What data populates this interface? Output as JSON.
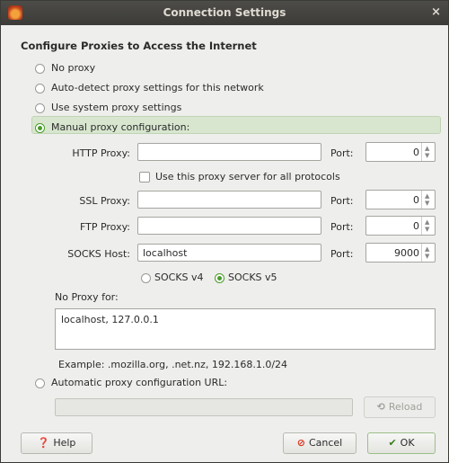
{
  "window": {
    "title": "Connection Settings",
    "close_glyph": "×",
    "app_icon": "firefox-icon"
  },
  "section_heading": "Configure Proxies to Access the Internet",
  "options": {
    "no_proxy": "No proxy",
    "auto_detect": "Auto-detect proxy settings for this network",
    "system_proxy": "Use system proxy settings",
    "manual": "Manual proxy configuration:",
    "selected": "manual"
  },
  "manual": {
    "http": {
      "label": "HTTP Proxy:",
      "value": "",
      "port_label": "Port:",
      "port": "0"
    },
    "use_all": {
      "label": "Use this proxy server for all protocols",
      "checked": false
    },
    "ssl": {
      "label": "SSL Proxy:",
      "value": "",
      "port_label": "Port:",
      "port": "0"
    },
    "ftp": {
      "label": "FTP Proxy:",
      "value": "",
      "port_label": "Port:",
      "port": "0"
    },
    "socks": {
      "label": "SOCKS Host:",
      "value": "localhost",
      "port_label": "Port:",
      "port": "9000"
    },
    "socks_v4": "SOCKS v4",
    "socks_v5": "SOCKS v5",
    "socks_selected": "v5"
  },
  "no_proxy": {
    "label": "No Proxy for:",
    "value": "localhost, 127.0.0.1",
    "example": "Example: .mozilla.org, .net.nz, 192.168.1.0/24"
  },
  "auto_config": {
    "label": "Automatic proxy configuration URL:",
    "value": "",
    "reload": "Reload"
  },
  "buttons": {
    "help": "Help",
    "cancel": "Cancel",
    "ok": "OK"
  },
  "colors": {
    "accent": "#4a9b2a",
    "titlebar": "#3c3b37",
    "cancel_icon": "#d9331b"
  }
}
